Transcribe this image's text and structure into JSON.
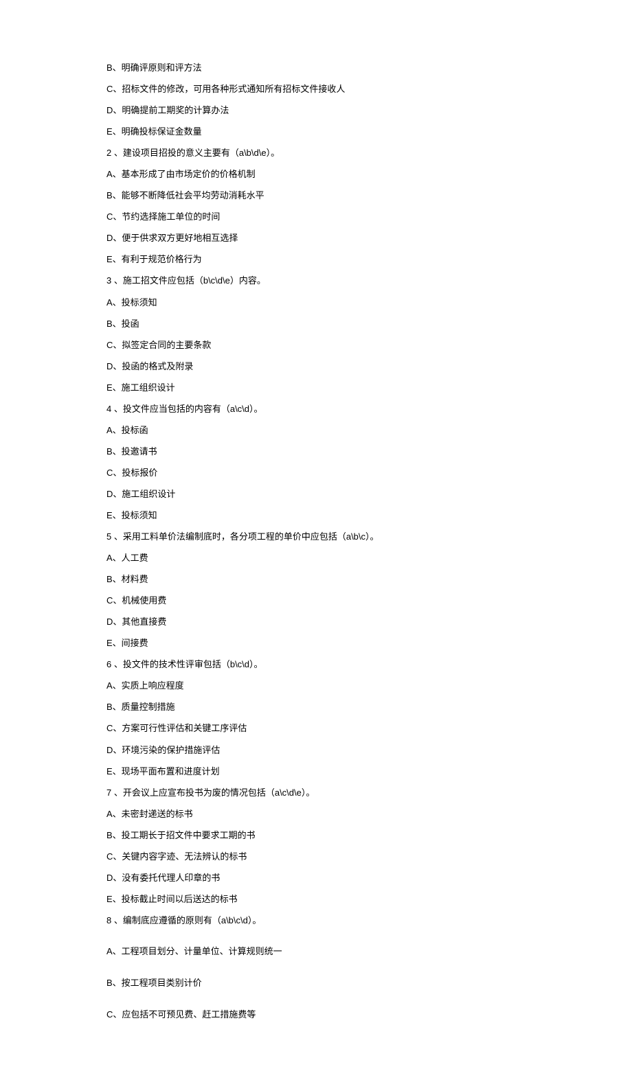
{
  "lines": [
    "B、明确评原则和评方法",
    "C、招标文件的修改，可用各种形式通知所有招标文件接收人",
    "D、明确提前工期奖的计算办法",
    "E、明确投标保证金数量",
    "2 、建设项目招投的意义主要有（a\\b\\d\\e）。",
    "A、基本形成了由市场定价的价格机制",
    "B、能够不断降低社会平均劳动消耗水平",
    "C、节约选择施工单位的时间",
    "D、便于供求双方更好地相互选择",
    "E、有利于规范价格行为",
    "3 、施工招文件应包括（b\\c\\d\\e）内容。",
    "A、投标须知",
    "B、投函",
    "C、拟签定合同的主要条款",
    "D、投函的格式及附录",
    "E、施工组织设计",
    "4 、投文件应当包括的内容有（a\\c\\d）。",
    "A、投标函",
    "B、投邀请书",
    "C、投标报价",
    "D、施工组织设计",
    "E、投标须知",
    "5 、采用工料单价法编制底时，各分项工程的单价中应包括（a\\b\\c）。",
    "A、人工费",
    "B、材料费",
    "C、机械使用费",
    "D、其他直接费",
    "E、间接费",
    "6 、投文件的技术性评审包括（b\\c\\d）。",
    "A、实质上响应程度",
    "B、质量控制措施",
    "C、方案可行性评估和关键工序评估",
    "D、环境污染的保护措施评估",
    "E、现场平面布置和进度计划",
    "7 、开会议上应宣布投书为废的情况包括（a\\c\\d\\e）。",
    "A、未密封递送的标书",
    "B、投工期长于招文件中要求工期的书",
    "C、关键内容字迹、无法辨认的标书",
    "D、没有委托代理人印章的书",
    "E、投标截止时间以后送达的标书",
    "8 、编制底应遵循的原则有（a\\b\\c\\d）。",
    "A、工程项目划分、计量单位、计算规则统一",
    "B、按工程项目类别计价",
    "C、应包括不可预见费、赶工措施费等"
  ],
  "spaced_indices": [
    41,
    42,
    43
  ]
}
